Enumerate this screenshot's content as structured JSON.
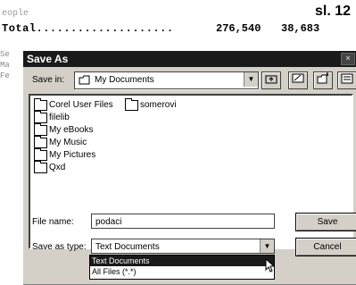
{
  "background": {
    "people_text": "eople",
    "total_label": "Total....................",
    "total_value_1": "276,540",
    "total_value_2": "38,683",
    "side_fragments": [
      "Se",
      "Ma",
      "Fe"
    ]
  },
  "slide_label": "sl. 12",
  "dialog": {
    "title": "Save As",
    "save_in_label": "Save in:",
    "save_in_value": "My Documents",
    "toolbar_icons": [
      "up-one-level-icon",
      "desktop-icon",
      "new-folder-icon",
      "view-menu-icon"
    ],
    "folders_col1": [
      "Corel User Files",
      "filelib",
      "My eBooks",
      "My Music",
      "My Pictures",
      "Qxd"
    ],
    "folders_col2": [
      "somerovi"
    ],
    "file_name_label": "File name:",
    "file_name_value": "podaci",
    "save_as_type_label": "Save as type:",
    "save_as_type_value": "Text Documents",
    "save_button": "Save",
    "cancel_button": "Cancel",
    "type_options": [
      "Text Documents",
      "All Files (*.*)"
    ]
  }
}
